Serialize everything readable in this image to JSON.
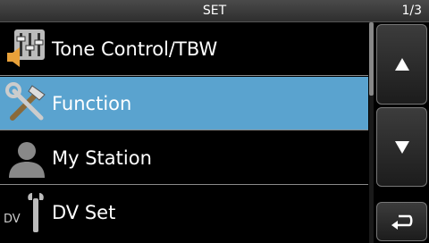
{
  "header": {
    "title": "SET",
    "page_indicator": "1/3"
  },
  "menu": {
    "items": [
      {
        "label": "Tone Control/TBW",
        "icon": "tone-control-icon",
        "selected": false
      },
      {
        "label": "Function",
        "icon": "tools-icon",
        "selected": true
      },
      {
        "label": "My Station",
        "icon": "person-icon",
        "selected": false
      },
      {
        "label": "DV Set",
        "icon": "dv-wrench-icon",
        "icon_text": "DV",
        "selected": false
      }
    ]
  },
  "buttons": {
    "up": "up-arrow-icon",
    "down": "down-arrow-icon",
    "back": "return-arrow-icon"
  },
  "colors": {
    "selected_row": "#5aa3cf",
    "background": "#000000"
  }
}
